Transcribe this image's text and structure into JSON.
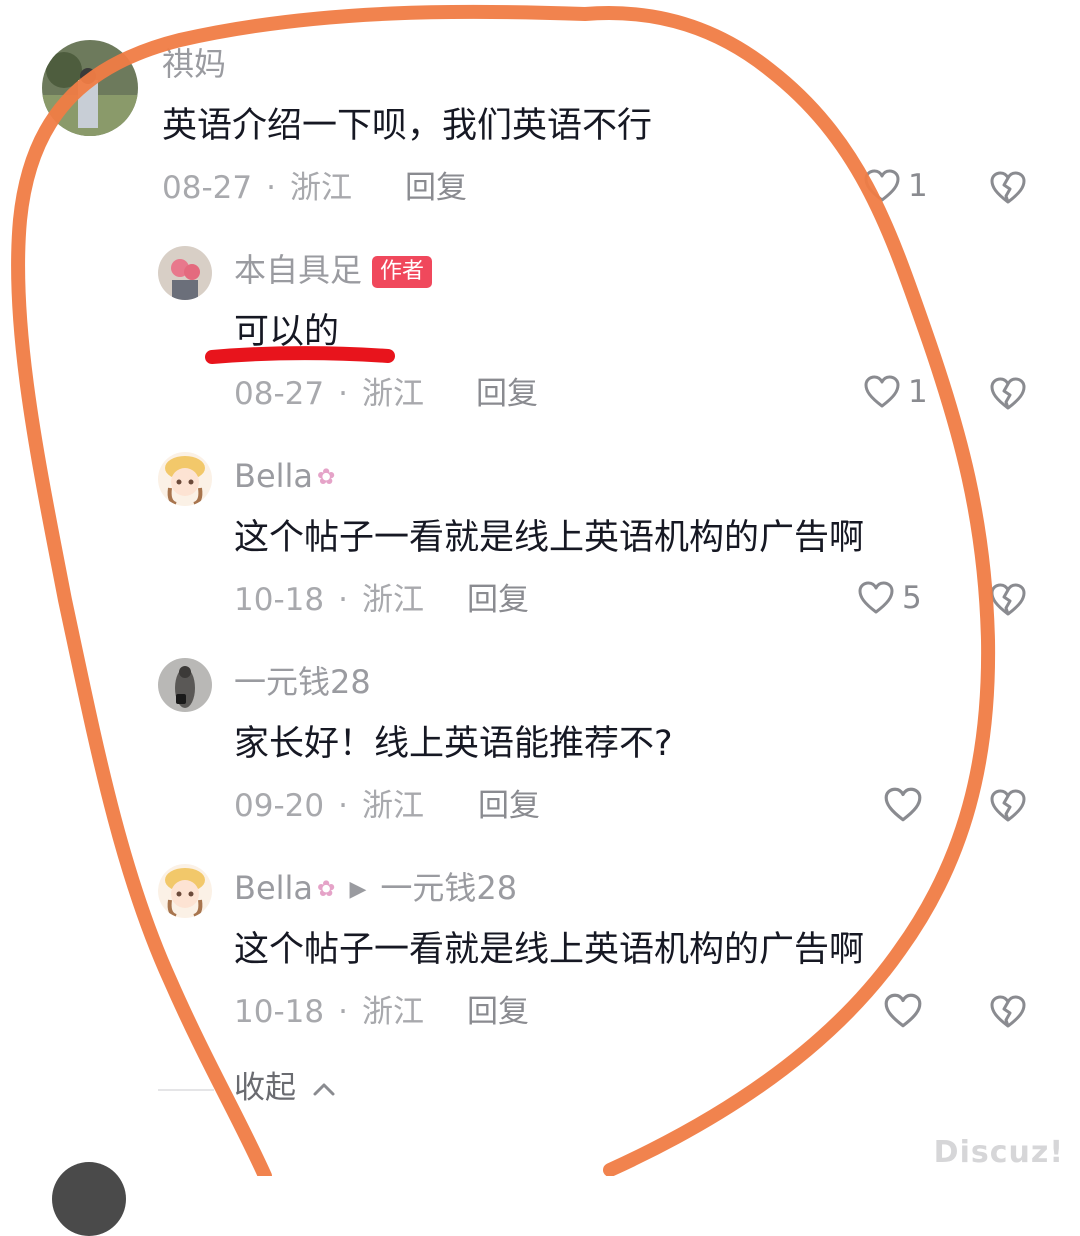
{
  "comments": [
    {
      "username": "祺妈",
      "text": "英语介绍一下呗，我们英语不行",
      "date": "08-27",
      "location": "浙江",
      "reply_label": "回复",
      "likes": "1"
    },
    {
      "username": "本自具足",
      "badge": "作者",
      "text": "可以的",
      "date": "08-27",
      "location": "浙江",
      "reply_label": "回复",
      "likes": "1"
    },
    {
      "username": "Bella",
      "text": "这个帖子一看就是线上英语机构的广告啊",
      "date": "10-18",
      "location": "浙江",
      "reply_label": "回复",
      "likes": "5"
    },
    {
      "username": "一元钱28",
      "text": "家长好！线上英语能推荐不?",
      "date": "09-20",
      "location": "浙江",
      "reply_label": "回复",
      "likes": ""
    },
    {
      "username": "Bella",
      "reply_to": "一元钱28",
      "text": "这个帖子一看就是线上英语机构的广告啊",
      "date": "10-18",
      "location": "浙江",
      "reply_label": "回复",
      "likes": ""
    }
  ],
  "collapse_label": "收起",
  "watermark": "Discuz!",
  "icons": {
    "like": "heart-outline-icon",
    "dislike": "broken-heart-icon",
    "collapse": "chevron-up-icon",
    "reply_arrow": "play-arrow-icon"
  },
  "colors": {
    "annotation_circle": "#f07c45",
    "annotation_underline": "#e8141c",
    "author_badge": "#f0485c"
  }
}
